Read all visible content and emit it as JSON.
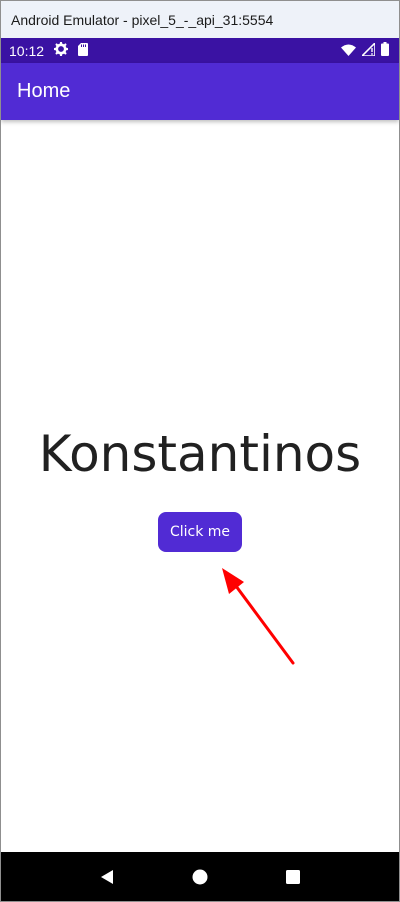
{
  "window": {
    "title": "Android Emulator - pixel_5_-_api_31:5554"
  },
  "statusbar": {
    "time": "10:12",
    "icons": [
      "settings-icon",
      "sd-card-icon",
      "wifi-icon",
      "signal-icon",
      "battery-icon"
    ]
  },
  "appbar": {
    "title": "Home"
  },
  "main": {
    "name_label": "Konstantinos",
    "button_label": "Click me"
  },
  "navbar": {
    "icons": [
      "back-icon",
      "home-icon",
      "recents-icon"
    ]
  },
  "colors": {
    "statusbar": "#3a12a3",
    "primary": "#512bd4",
    "annotation": "#ff0000"
  }
}
